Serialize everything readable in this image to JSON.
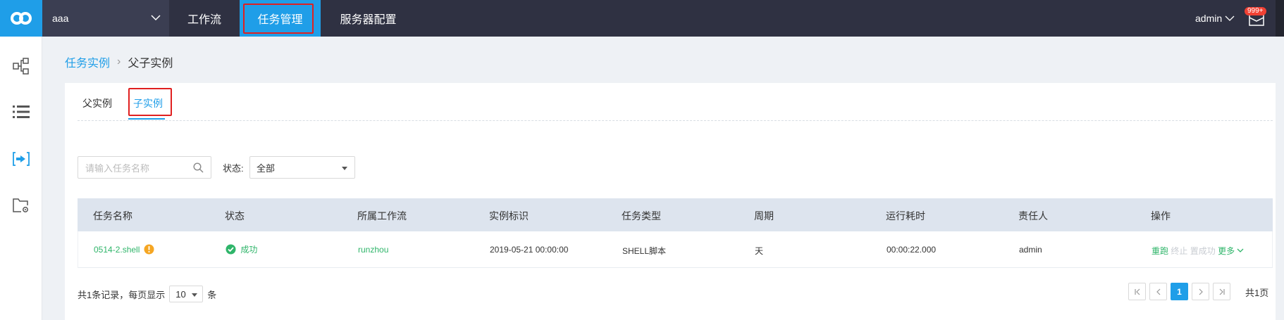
{
  "header": {
    "project_name": "aaa",
    "nav": [
      {
        "label": "工作流"
      },
      {
        "label": "任务管理"
      },
      {
        "label": "服务器配置"
      }
    ],
    "user": "admin",
    "notifications": "999+"
  },
  "sidebar": {
    "icons": [
      "workflow-tree-icon",
      "list-icon",
      "task-instance-icon",
      "folder-settings-icon"
    ]
  },
  "breadcrumb": {
    "parent": "任务实例",
    "current": "父子实例"
  },
  "tabs": [
    "父实例",
    "子实例"
  ],
  "filters": {
    "search_placeholder": "请输入任务名称",
    "state_label": "状态:",
    "state_value": "全部"
  },
  "table": {
    "columns": [
      "任务名称",
      "状态",
      "所属工作流",
      "实例标识",
      "任务类型",
      "周期",
      "运行耗时",
      "责任人",
      "操作"
    ],
    "rows": [
      {
        "name": "0514-2.shell",
        "status": "成功",
        "workflow": "runzhou",
        "instance_id": "2019-05-21 00:00:00",
        "type": "SHELL脚本",
        "cycle": "天",
        "duration": "00:00:22.000",
        "owner": "admin",
        "actions": {
          "rerun": "重跑",
          "stop": "终止",
          "set_success": "置成功",
          "more": "更多"
        }
      }
    ]
  },
  "pagination": {
    "summary_prefix": "共1条记录，每页显示",
    "page_size": "10",
    "summary_suffix": "条",
    "current_page": "1",
    "total_pages": "共1页"
  },
  "colors": {
    "accent": "#1f9ee8",
    "topbar": "#2f3142",
    "success": "#2fb56a",
    "highlight": "#e02020"
  }
}
